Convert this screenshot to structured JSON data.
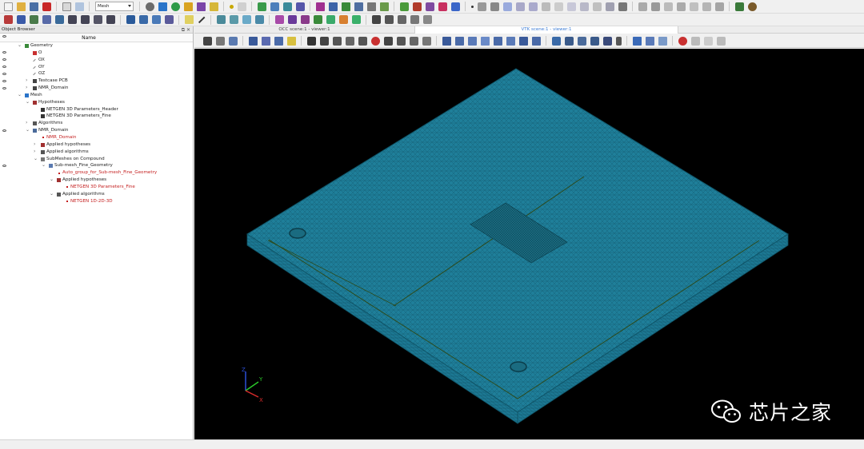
{
  "toolbar": {
    "module_combo": "Mesh"
  },
  "object_browser": {
    "title": "Object Browser",
    "column_name": "Name",
    "tree": [
      {
        "label": "Geometry",
        "level": 0,
        "expand": "minus",
        "eye": false,
        "red": false,
        "icon": "geometry-icon"
      },
      {
        "label": "O",
        "level": 1,
        "expand": "",
        "eye": true,
        "red": false,
        "icon": "origin-point-icon"
      },
      {
        "label": "OX",
        "level": 1,
        "expand": "",
        "eye": true,
        "red": false,
        "icon": "axis-icon"
      },
      {
        "label": "OY",
        "level": 1,
        "expand": "",
        "eye": true,
        "red": false,
        "icon": "axis-icon"
      },
      {
        "label": "OZ",
        "level": 1,
        "expand": "",
        "eye": true,
        "red": false,
        "icon": "axis-icon"
      },
      {
        "label": "Testcase PCB",
        "level": 1,
        "expand": "plus",
        "eye": true,
        "red": false,
        "icon": "compound-icon"
      },
      {
        "label": "NMR_Domain",
        "level": 1,
        "expand": "plus",
        "eye": true,
        "red": false,
        "icon": "compound-icon"
      },
      {
        "label": "Mesh",
        "level": 0,
        "expand": "minus",
        "eye": false,
        "red": false,
        "icon": "mesh-module-icon"
      },
      {
        "label": "Hypotheses",
        "level": 1,
        "expand": "minus",
        "eye": false,
        "red": false,
        "icon": "hypotheses-icon"
      },
      {
        "label": "NETGEN 3D Parameters_Header",
        "level": 2,
        "expand": "",
        "eye": false,
        "red": false,
        "icon": "hypothesis-icon"
      },
      {
        "label": "NETGEN 3D Parameters_Fine",
        "level": 2,
        "expand": "",
        "eye": false,
        "red": false,
        "icon": "hypothesis-icon"
      },
      {
        "label": "Algorithms",
        "level": 1,
        "expand": "plus",
        "eye": false,
        "red": false,
        "icon": "algorithms-icon"
      },
      {
        "label": "NMR_Domain",
        "level": 1,
        "expand": "minus",
        "eye": true,
        "red": false,
        "icon": "mesh-icon"
      },
      {
        "label": "NMR_Domain",
        "level": 2,
        "expand": "",
        "eye": false,
        "red": true,
        "icon": "reference-icon"
      },
      {
        "label": "Applied hypotheses",
        "level": 2,
        "expand": "plus",
        "eye": false,
        "red": false,
        "icon": "hypotheses-icon"
      },
      {
        "label": "Applied algorithms",
        "level": 2,
        "expand": "plus",
        "eye": false,
        "red": false,
        "icon": "algorithms-icon"
      },
      {
        "label": "SubMeshes on Compound",
        "level": 2,
        "expand": "minus",
        "eye": false,
        "red": false,
        "icon": "folder-icon"
      },
      {
        "label": "Sub-mesh_Fine_Geometry",
        "level": 3,
        "expand": "minus",
        "eye": true,
        "red": false,
        "icon": "submesh-icon"
      },
      {
        "label": "Auto_group_for_Sub-mesh_Fine_Geometry",
        "level": 4,
        "expand": "",
        "eye": false,
        "red": true,
        "icon": "reference-icon"
      },
      {
        "label": "Applied hypotheses",
        "level": 4,
        "expand": "minus",
        "eye": false,
        "red": false,
        "icon": "hypotheses-icon"
      },
      {
        "label": "NETGEN 3D Parameters_Fine",
        "level": 5,
        "expand": "",
        "eye": false,
        "red": true,
        "icon": "reference-icon"
      },
      {
        "label": "Applied algorithms",
        "level": 4,
        "expand": "minus",
        "eye": false,
        "red": false,
        "icon": "algorithms-icon"
      },
      {
        "label": "NETGEN 1D-2D-3D",
        "level": 5,
        "expand": "",
        "eye": false,
        "red": true,
        "icon": "reference-icon"
      }
    ]
  },
  "viewer": {
    "tab_occ": "OCC scene:1 - viewer:1",
    "tab_vtk": "VTK scene:1 - viewer:1",
    "mesh_color": "#1f7f9a",
    "mesh_dark": "#0f5366",
    "axes": {
      "x": "X",
      "y": "Y",
      "z": "Z"
    }
  },
  "watermark": {
    "text": "芯片之家",
    "icon": "wechat-icon"
  },
  "colors": {
    "accent_blue": "#3a7bd5",
    "reference_red": "#c41e1e",
    "viewport_bg": "#000000"
  }
}
